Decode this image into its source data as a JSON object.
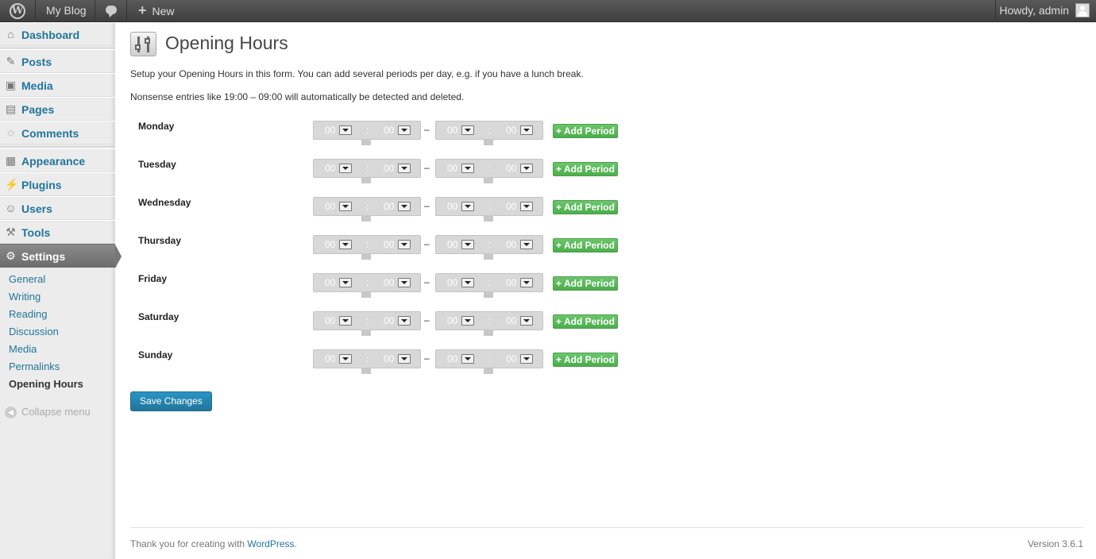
{
  "adminbar": {
    "logo_icon": "wordpress-logo-icon",
    "site_name": "My Blog",
    "comments_icon": "comment-bubble-icon",
    "new_label": "New",
    "new_icon": "plus-icon",
    "greeting": "Howdy, admin",
    "avatar_icon": "user-avatar-icon"
  },
  "sidebar": {
    "items": [
      {
        "label": "Dashboard",
        "icon": "dashboard-icon"
      },
      {
        "label": "Posts",
        "icon": "pin-icon"
      },
      {
        "label": "Media",
        "icon": "media-icon"
      },
      {
        "label": "Pages",
        "icon": "pages-icon"
      },
      {
        "label": "Comments",
        "icon": "comments-icon"
      },
      {
        "label": "Appearance",
        "icon": "appearance-icon"
      },
      {
        "label": "Plugins",
        "icon": "plugin-icon"
      },
      {
        "label": "Users",
        "icon": "users-icon"
      },
      {
        "label": "Tools",
        "icon": "tools-icon"
      },
      {
        "label": "Settings",
        "icon": "settings-icon",
        "current": true
      }
    ],
    "submenu": [
      {
        "label": "General"
      },
      {
        "label": "Writing"
      },
      {
        "label": "Reading"
      },
      {
        "label": "Discussion"
      },
      {
        "label": "Media"
      },
      {
        "label": "Permalinks"
      },
      {
        "label": "Opening Hours",
        "active": true
      }
    ],
    "collapse_label": "Collapse menu"
  },
  "main": {
    "title": "Opening Hours",
    "description": "Setup your Opening Hours in this form. You can add several periods per day, e.g. if you have a lunch break.",
    "note": "Nonsense entries like 19:00 – 09:00 will automatically be detected and deleted.",
    "separator": "–",
    "colon": ":",
    "add_period_label": "+ Add Period",
    "days": [
      {
        "name": "Monday",
        "start_hour": "00",
        "start_min": "00",
        "end_hour": "00",
        "end_min": "00"
      },
      {
        "name": "Tuesday",
        "start_hour": "00",
        "start_min": "00",
        "end_hour": "00",
        "end_min": "00"
      },
      {
        "name": "Wednesday",
        "start_hour": "00",
        "start_min": "00",
        "end_hour": "00",
        "end_min": "00"
      },
      {
        "name": "Thursday",
        "start_hour": "00",
        "start_min": "00",
        "end_hour": "00",
        "end_min": "00"
      },
      {
        "name": "Friday",
        "start_hour": "00",
        "start_min": "00",
        "end_hour": "00",
        "end_min": "00"
      },
      {
        "name": "Saturday",
        "start_hour": "00",
        "start_min": "00",
        "end_hour": "00",
        "end_min": "00"
      },
      {
        "name": "Sunday",
        "start_hour": "00",
        "start_min": "00",
        "end_hour": "00",
        "end_min": "00"
      }
    ],
    "save_label": "Save Changes"
  },
  "footer": {
    "thanks_prefix": "Thank you for creating with ",
    "thanks_link": "WordPress",
    "thanks_suffix": ".",
    "version": "Version 3.6.1"
  },
  "colors": {
    "link": "#21759b",
    "accent_green": "#5cb85c",
    "primary_button": "#2a95c5",
    "adminbar_bg": "#464646"
  }
}
